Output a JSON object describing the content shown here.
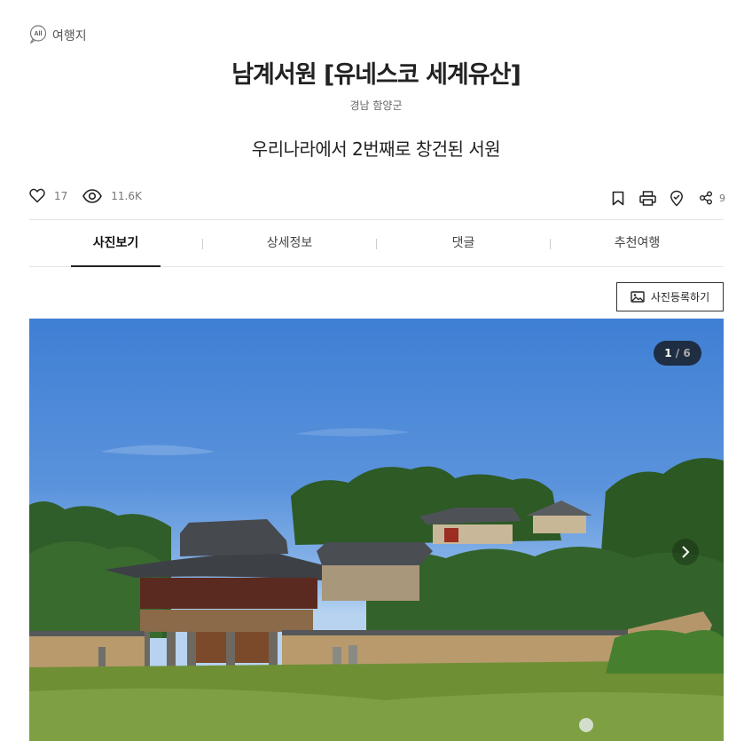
{
  "category": {
    "icon_text": "All",
    "label": "여행지"
  },
  "title": "남계서원 [유네스코 세계유산]",
  "region": "경남 함양군",
  "subtitle": "우리나라에서 2번째로 창건된 서원",
  "stats": {
    "likes": "17",
    "views": "11.6K",
    "shares": "9"
  },
  "tabs": [
    {
      "label": "사진보기",
      "active": true
    },
    {
      "label": "상세정보",
      "active": false
    },
    {
      "label": "댓글",
      "active": false
    },
    {
      "label": "추천여행",
      "active": false
    }
  ],
  "upload_button": "사진등록하기",
  "gallery": {
    "current": "1",
    "separator": " / ",
    "total": "6"
  },
  "icons": [
    "heart-icon",
    "eye-icon",
    "bookmark-icon",
    "print-icon",
    "map-pin-icon",
    "share-icon",
    "image-icon",
    "chevron-right-icon"
  ]
}
